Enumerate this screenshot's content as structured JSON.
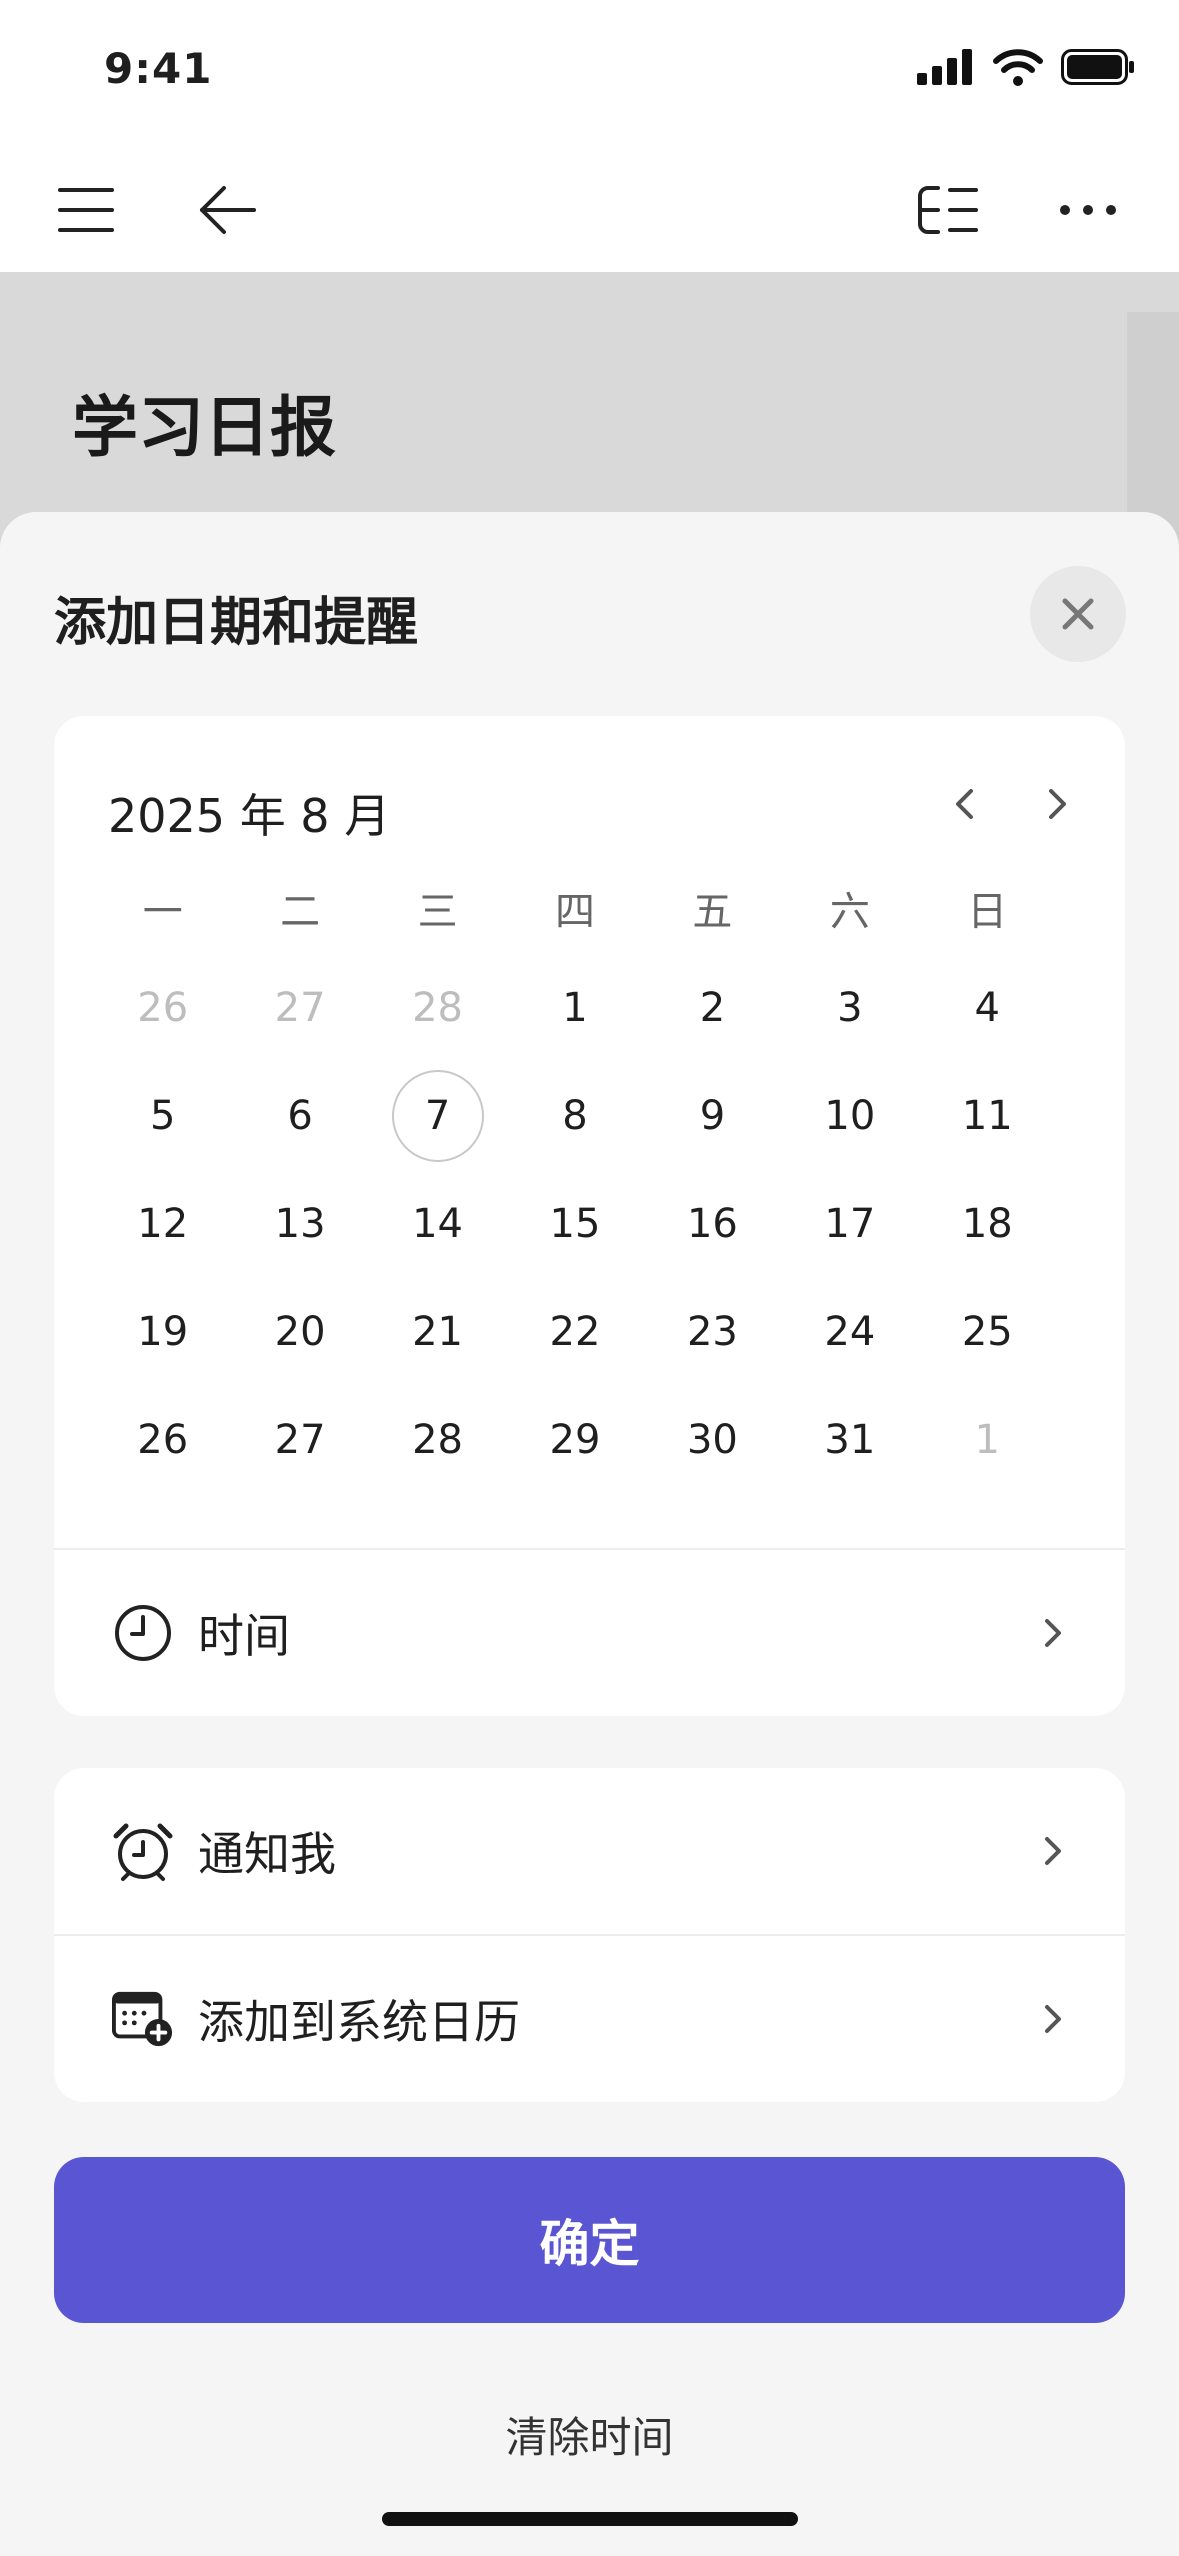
{
  "status_bar": {
    "time": "9:41"
  },
  "page": {
    "title": "学习日报"
  },
  "sheet": {
    "title": "添加日期和提醒",
    "calendar": {
      "month_label": "2025 年 8 月",
      "weekdays": [
        "一",
        "二",
        "三",
        "四",
        "五",
        "六",
        "日"
      ],
      "days": [
        {
          "label": "26",
          "muted": true
        },
        {
          "label": "27",
          "muted": true
        },
        {
          "label": "28",
          "muted": true
        },
        {
          "label": "1"
        },
        {
          "label": "2"
        },
        {
          "label": "3"
        },
        {
          "label": "4"
        },
        {
          "label": "5"
        },
        {
          "label": "6"
        },
        {
          "label": "7",
          "selected": true
        },
        {
          "label": "8"
        },
        {
          "label": "9"
        },
        {
          "label": "10"
        },
        {
          "label": "11"
        },
        {
          "label": "12"
        },
        {
          "label": "13"
        },
        {
          "label": "14"
        },
        {
          "label": "15"
        },
        {
          "label": "16"
        },
        {
          "label": "17"
        },
        {
          "label": "18"
        },
        {
          "label": "19"
        },
        {
          "label": "20"
        },
        {
          "label": "21"
        },
        {
          "label": "22"
        },
        {
          "label": "23"
        },
        {
          "label": "24"
        },
        {
          "label": "25"
        },
        {
          "label": "26"
        },
        {
          "label": "27"
        },
        {
          "label": "28"
        },
        {
          "label": "29"
        },
        {
          "label": "30"
        },
        {
          "label": "31"
        },
        {
          "label": "1",
          "muted": true
        }
      ],
      "time_label": "时间"
    },
    "notify_label": "通知我",
    "system_calendar_label": "添加到系统日历",
    "confirm_label": "确定",
    "clear_label": "清除时间"
  },
  "colors": {
    "accent": "#5a55d2",
    "sheet_bg": "#f5f5f5",
    "muted_text": "#bdbdbd"
  },
  "icons": {
    "menu": "menu-icon",
    "back": "arrow-left-icon",
    "outline": "outline-icon",
    "more": "more-icon",
    "close": "close-icon",
    "clock": "clock-icon",
    "alarm": "alarm-clock-icon",
    "calendar_add": "calendar-add-icon"
  }
}
